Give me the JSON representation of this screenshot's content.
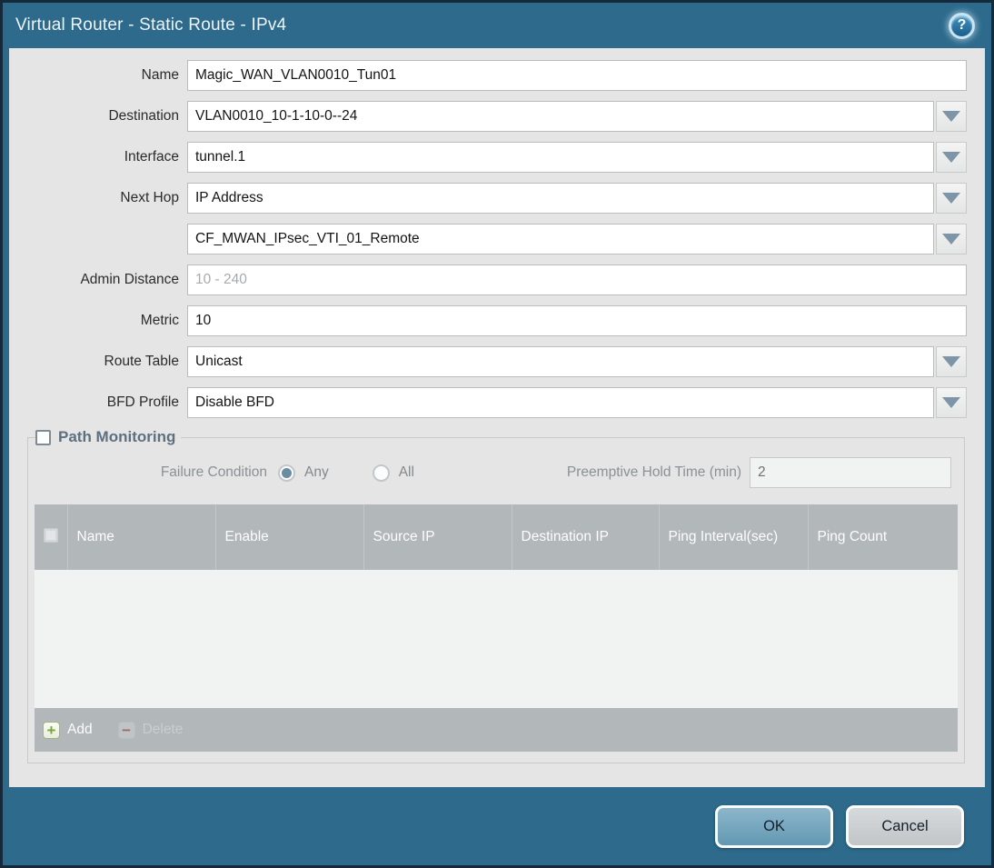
{
  "window": {
    "title": "Virtual Router - Static Route - IPv4",
    "help_glyph": "?"
  },
  "colors": {
    "frame_teal": "#2d6a8c",
    "outer_border": "#15293a",
    "content_bg": "#e4e5e4",
    "table_header_bg": "#b2b7ba",
    "ok_button": "#6f9fba",
    "cancel_button": "#c9cdd0",
    "radio_selected_dot": "#6b8da2",
    "add_icon_green": "#7da33e",
    "delete_icon_red": "#9b5050"
  },
  "form": {
    "fields": [
      {
        "label": "Name",
        "value": "Magic_WAN_VLAN0010_Tun01",
        "type": "text"
      },
      {
        "label": "Destination",
        "value": "VLAN0010_10-1-10-0--24",
        "type": "dropdown"
      },
      {
        "label": "Interface",
        "value": "tunnel.1",
        "type": "dropdown"
      },
      {
        "label": "Next Hop",
        "value": "IP Address",
        "type": "dropdown"
      },
      {
        "label": "",
        "value": "CF_MWAN_IPsec_VTI_01_Remote",
        "type": "dropdown"
      },
      {
        "label": "Admin Distance",
        "value": "",
        "placeholder": "10 - 240",
        "type": "text"
      },
      {
        "label": "Metric",
        "value": "10",
        "type": "text"
      },
      {
        "label": "Route Table",
        "value": "Unicast",
        "type": "dropdown"
      },
      {
        "label": "BFD Profile",
        "value": "Disable BFD",
        "type": "dropdown"
      }
    ]
  },
  "path_monitoring": {
    "legend": "Path Monitoring",
    "checkbox_checked": false,
    "failure_condition_label": "Failure Condition",
    "radio_any_label": "Any",
    "radio_any_selected": true,
    "radio_all_label": "All",
    "radio_all_selected": false,
    "preemptive_label": "Preemptive Hold Time (min)",
    "preemptive_value": "2",
    "table": {
      "columns": [
        "Name",
        "Enable",
        "Source IP",
        "Destination IP",
        "Ping Interval(sec)",
        "Ping Count"
      ],
      "rows": []
    },
    "add_label": "Add",
    "delete_label": "Delete"
  },
  "footer": {
    "ok_label": "OK",
    "cancel_label": "Cancel"
  }
}
